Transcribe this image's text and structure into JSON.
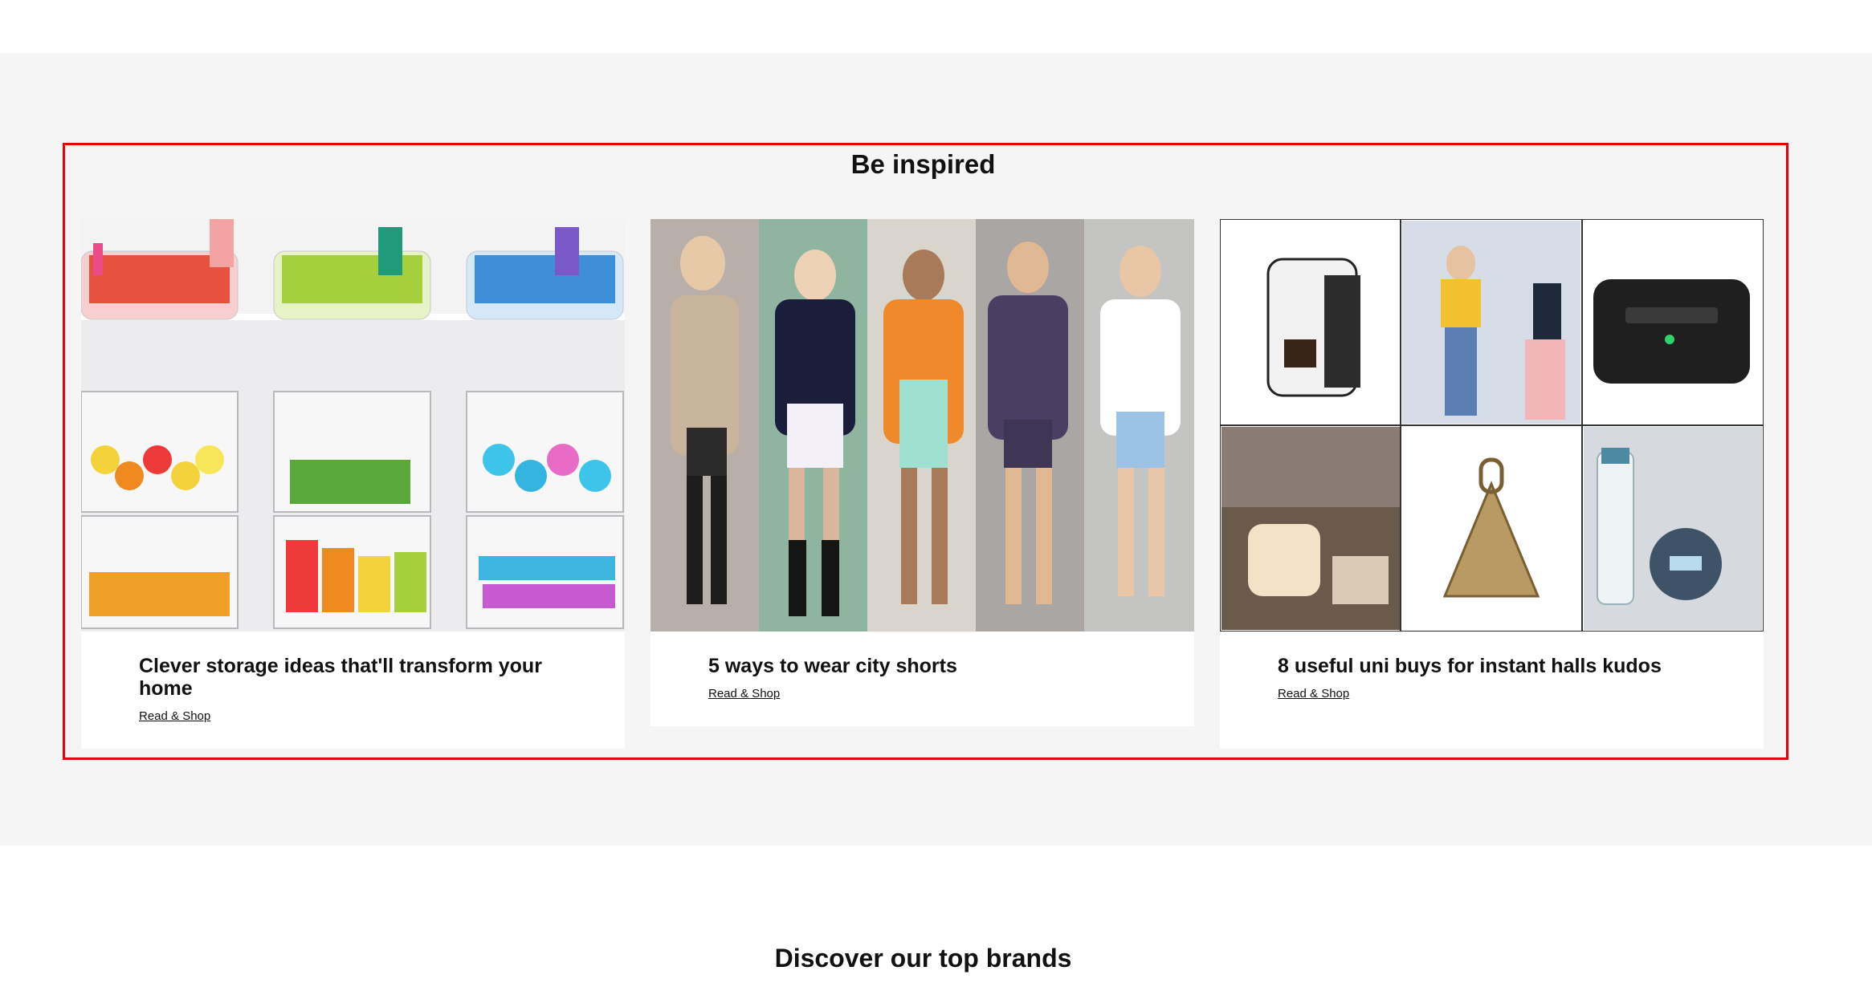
{
  "inspiration": {
    "heading": "Be inspired",
    "cards": [
      {
        "title": "Clever storage ideas that'll transform your home",
        "link_label": "Read & Shop",
        "image": "storage-bins-photo"
      },
      {
        "title": "5 ways to wear city shorts",
        "link_label": "Read & Shop",
        "image": "street-style-shorts-photo"
      },
      {
        "title": "8 useful uni buys for instant halls kudos",
        "link_label": "Read & Shop",
        "image": "uni-products-collage"
      }
    ]
  },
  "brands": {
    "heading": "Discover our top brands"
  },
  "colors": {
    "highlight_border": "#e4000f",
    "band_background": "#f5f5f5"
  }
}
